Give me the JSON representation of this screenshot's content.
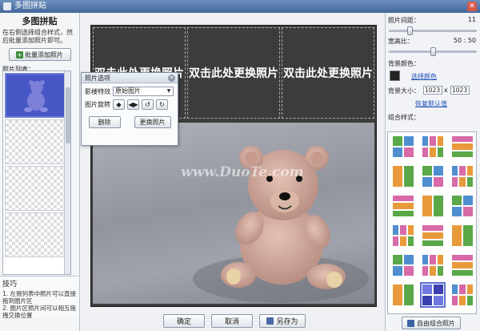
{
  "window": {
    "title": "多图拼贴",
    "close_glyph": "✕"
  },
  "left_panel": {
    "title": "多图拼贴",
    "description": "在右侧选择组合样式，然后批量添加照片即可。",
    "batch_add_label": "批量添加照片",
    "photo_list_label": "照片列表：",
    "tips_title": "技巧",
    "tips": [
      "1. 左侧列表中照片可以直接拖到图片区",
      "2. 图片区照片间可以相互拖拽交换位置"
    ]
  },
  "canvas": {
    "placeholder_cells": [
      "双击此处更换照片",
      "双击此处更换照片",
      "双击此处更换照片"
    ],
    "watermark": "www.DuoTe.com",
    "background_color": "#3c3c3c"
  },
  "photo_dialog": {
    "title": "照片选项",
    "effect_label": "影楼特效",
    "effect_value": "原始图片",
    "rotate_label": "图片旋转",
    "delete_label": "删除",
    "replace_label": "更换照片"
  },
  "bottom_bar": {
    "ok_label": "确定",
    "cancel_label": "取消",
    "save_as_label": "另存为"
  },
  "right_panel": {
    "spacing_label": "照片间距：",
    "spacing_value": "11",
    "spacing_fraction": 0.22,
    "ratio_label": "宽高比：",
    "ratio_value": "50 : 50",
    "ratio_fraction": 0.5,
    "bg_color_label": "背景颜色：",
    "bg_color": "#222222",
    "choose_color_label": "选择颜色",
    "bg_size_label": "背景大小：",
    "bg_width": "1023",
    "size_separator": "x",
    "bg_height": "1023",
    "restore_default_label": "恢复默认值",
    "styles_label": "组合样式：",
    "free_combo_label": "自由组合照片"
  },
  "colors": {
    "accent": "#5b6fd0",
    "titlebar": "#4f74a8",
    "tile_green": "#5aa848",
    "tile_blue": "#4f8fd0",
    "tile_pink": "#d86aa8",
    "tile_orange": "#e89a3a"
  }
}
